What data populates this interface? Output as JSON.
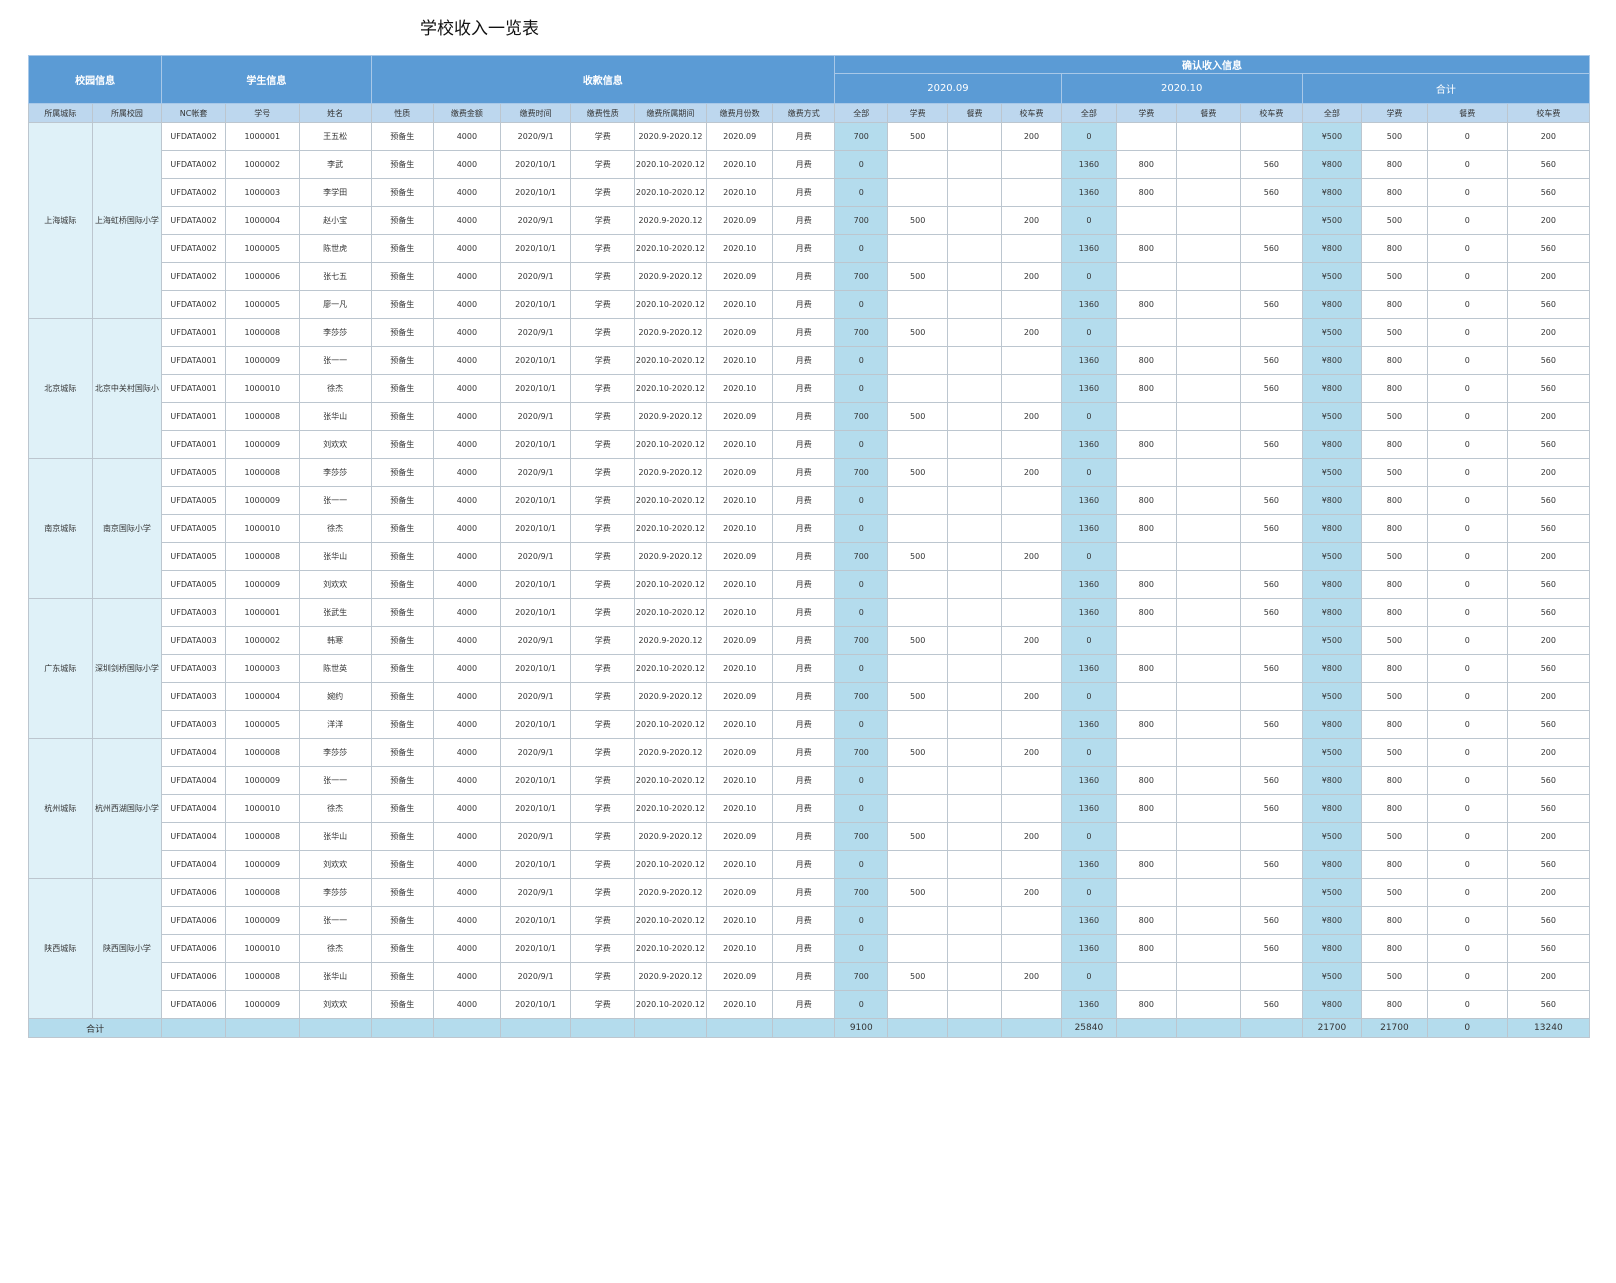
{
  "title": "学校收入一览表",
  "groups": {
    "campus": "校园信息",
    "student": "学生信息",
    "payment": "收款信息",
    "confirm": "确认收入信息"
  },
  "periods": [
    "2020.09",
    "2020.10",
    "合计"
  ],
  "columns": [
    "所属城际",
    "所属校园",
    "NC帐套",
    "学号",
    "姓名",
    "性质",
    "缴费金额",
    "缴费时间",
    "缴费性质",
    "缴费所属期间",
    "缴费月份数",
    "缴费方式",
    "全部",
    "学费",
    "餐费",
    "校车费",
    "全部",
    "学费",
    "餐费",
    "校车费",
    "全部",
    "学费",
    "餐费",
    "校车费"
  ],
  "sections": [
    {
      "city": "上海城际",
      "campus": "上海虹桥国际小学",
      "rows": [
        [
          "UFDATA002",
          "1000001",
          "王五松",
          "预备生",
          "4000",
          "2020/9/1",
          "学费",
          "2020.9-2020.12",
          "2020.09",
          "月费",
          "700",
          "500",
          "",
          "200",
          "0",
          "",
          "",
          "",
          "¥500",
          "500",
          "0",
          "200"
        ],
        [
          "UFDATA002",
          "1000002",
          "李武",
          "预备生",
          "4000",
          "2020/10/1",
          "学费",
          "2020.10-2020.12",
          "2020.10",
          "月费",
          "0",
          "",
          "",
          "",
          "1360",
          "800",
          "",
          "560",
          "¥800",
          "800",
          "0",
          "560"
        ],
        [
          "UFDATA002",
          "1000003",
          "李学田",
          "预备生",
          "4000",
          "2020/10/1",
          "学费",
          "2020.10-2020.12",
          "2020.10",
          "月费",
          "0",
          "",
          "",
          "",
          "1360",
          "800",
          "",
          "560",
          "¥800",
          "800",
          "0",
          "560"
        ],
        [
          "UFDATA002",
          "1000004",
          "赵小宝",
          "预备生",
          "4000",
          "2020/9/1",
          "学费",
          "2020.9-2020.12",
          "2020.09",
          "月费",
          "700",
          "500",
          "",
          "200",
          "0",
          "",
          "",
          "",
          "¥500",
          "500",
          "0",
          "200"
        ],
        [
          "UFDATA002",
          "1000005",
          "陈世虎",
          "预备生",
          "4000",
          "2020/10/1",
          "学费",
          "2020.10-2020.12",
          "2020.10",
          "月费",
          "0",
          "",
          "",
          "",
          "1360",
          "800",
          "",
          "560",
          "¥800",
          "800",
          "0",
          "560"
        ],
        [
          "UFDATA002",
          "1000006",
          "张七五",
          "预备生",
          "4000",
          "2020/9/1",
          "学费",
          "2020.9-2020.12",
          "2020.09",
          "月费",
          "700",
          "500",
          "",
          "200",
          "0",
          "",
          "",
          "",
          "¥500",
          "500",
          "0",
          "200"
        ],
        [
          "UFDATA002",
          "1000005",
          "廖一凡",
          "预备生",
          "4000",
          "2020/10/1",
          "学费",
          "2020.10-2020.12",
          "2020.10",
          "月费",
          "0",
          "",
          "",
          "",
          "1360",
          "800",
          "",
          "560",
          "¥800",
          "800",
          "0",
          "560"
        ]
      ]
    },
    {
      "city": "北京城际",
      "campus": "北京中关村国际小",
      "rows": [
        [
          "UFDATA001",
          "1000008",
          "李莎莎",
          "预备生",
          "4000",
          "2020/9/1",
          "学费",
          "2020.9-2020.12",
          "2020.09",
          "月费",
          "700",
          "500",
          "",
          "200",
          "0",
          "",
          "",
          "",
          "¥500",
          "500",
          "0",
          "200"
        ],
        [
          "UFDATA001",
          "1000009",
          "张一一",
          "预备生",
          "4000",
          "2020/10/1",
          "学费",
          "2020.10-2020.12",
          "2020.10",
          "月费",
          "0",
          "",
          "",
          "",
          "1360",
          "800",
          "",
          "560",
          "¥800",
          "800",
          "0",
          "560"
        ],
        [
          "UFDATA001",
          "1000010",
          "徐杰",
          "预备生",
          "4000",
          "2020/10/1",
          "学费",
          "2020.10-2020.12",
          "2020.10",
          "月费",
          "0",
          "",
          "",
          "",
          "1360",
          "800",
          "",
          "560",
          "¥800",
          "800",
          "0",
          "560"
        ],
        [
          "UFDATA001",
          "1000008",
          "张华山",
          "预备生",
          "4000",
          "2020/9/1",
          "学费",
          "2020.9-2020.12",
          "2020.09",
          "月费",
          "700",
          "500",
          "",
          "200",
          "0",
          "",
          "",
          "",
          "¥500",
          "500",
          "0",
          "200"
        ],
        [
          "UFDATA001",
          "1000009",
          "刘欢欢",
          "预备生",
          "4000",
          "2020/10/1",
          "学费",
          "2020.10-2020.12",
          "2020.10",
          "月费",
          "0",
          "",
          "",
          "",
          "1360",
          "800",
          "",
          "560",
          "¥800",
          "800",
          "0",
          "560"
        ]
      ]
    },
    {
      "city": "南京城际",
      "campus": "南京国际小学",
      "rows": [
        [
          "UFDATA005",
          "1000008",
          "李莎莎",
          "预备生",
          "4000",
          "2020/9/1",
          "学费",
          "2020.9-2020.12",
          "2020.09",
          "月费",
          "700",
          "500",
          "",
          "200",
          "0",
          "",
          "",
          "",
          "¥500",
          "500",
          "0",
          "200"
        ],
        [
          "UFDATA005",
          "1000009",
          "张一一",
          "预备生",
          "4000",
          "2020/10/1",
          "学费",
          "2020.10-2020.12",
          "2020.10",
          "月费",
          "0",
          "",
          "",
          "",
          "1360",
          "800",
          "",
          "560",
          "¥800",
          "800",
          "0",
          "560"
        ],
        [
          "UFDATA005",
          "1000010",
          "徐杰",
          "预备生",
          "4000",
          "2020/10/1",
          "学费",
          "2020.10-2020.12",
          "2020.10",
          "月费",
          "0",
          "",
          "",
          "",
          "1360",
          "800",
          "",
          "560",
          "¥800",
          "800",
          "0",
          "560"
        ],
        [
          "UFDATA005",
          "1000008",
          "张华山",
          "预备生",
          "4000",
          "2020/9/1",
          "学费",
          "2020.9-2020.12",
          "2020.09",
          "月费",
          "700",
          "500",
          "",
          "200",
          "0",
          "",
          "",
          "",
          "¥500",
          "500",
          "0",
          "200"
        ],
        [
          "UFDATA005",
          "1000009",
          "刘欢欢",
          "预备生",
          "4000",
          "2020/10/1",
          "学费",
          "2020.10-2020.12",
          "2020.10",
          "月费",
          "0",
          "",
          "",
          "",
          "1360",
          "800",
          "",
          "560",
          "¥800",
          "800",
          "0",
          "560"
        ]
      ]
    },
    {
      "city": "广东城际",
      "campus": "深圳剑桥国际小学",
      "rows": [
        [
          "UFDATA003",
          "1000001",
          "张武生",
          "预备生",
          "4000",
          "2020/10/1",
          "学费",
          "2020.10-2020.12",
          "2020.10",
          "月费",
          "0",
          "",
          "",
          "",
          "1360",
          "800",
          "",
          "560",
          "¥800",
          "800",
          "0",
          "560"
        ],
        [
          "UFDATA003",
          "1000002",
          "韩寒",
          "预备生",
          "4000",
          "2020/9/1",
          "学费",
          "2020.9-2020.12",
          "2020.09",
          "月费",
          "700",
          "500",
          "",
          "200",
          "0",
          "",
          "",
          "",
          "¥500",
          "500",
          "0",
          "200"
        ],
        [
          "UFDATA003",
          "1000003",
          "陈世英",
          "预备生",
          "4000",
          "2020/10/1",
          "学费",
          "2020.10-2020.12",
          "2020.10",
          "月费",
          "0",
          "",
          "",
          "",
          "1360",
          "800",
          "",
          "560",
          "¥800",
          "800",
          "0",
          "560"
        ],
        [
          "UFDATA003",
          "1000004",
          "婉约",
          "预备生",
          "4000",
          "2020/9/1",
          "学费",
          "2020.9-2020.12",
          "2020.09",
          "月费",
          "700",
          "500",
          "",
          "200",
          "0",
          "",
          "",
          "",
          "¥500",
          "500",
          "0",
          "200"
        ],
        [
          "UFDATA003",
          "1000005",
          "洋洋",
          "预备生",
          "4000",
          "2020/10/1",
          "学费",
          "2020.10-2020.12",
          "2020.10",
          "月费",
          "0",
          "",
          "",
          "",
          "1360",
          "800",
          "",
          "560",
          "¥800",
          "800",
          "0",
          "560"
        ]
      ]
    },
    {
      "city": "杭州城际",
      "campus": "杭州西湖国际小学",
      "rows": [
        [
          "UFDATA004",
          "1000008",
          "李莎莎",
          "预备生",
          "4000",
          "2020/9/1",
          "学费",
          "2020.9-2020.12",
          "2020.09",
          "月费",
          "700",
          "500",
          "",
          "200",
          "0",
          "",
          "",
          "",
          "¥500",
          "500",
          "0",
          "200"
        ],
        [
          "UFDATA004",
          "1000009",
          "张一一",
          "预备生",
          "4000",
          "2020/10/1",
          "学费",
          "2020.10-2020.12",
          "2020.10",
          "月费",
          "0",
          "",
          "",
          "",
          "1360",
          "800",
          "",
          "560",
          "¥800",
          "800",
          "0",
          "560"
        ],
        [
          "UFDATA004",
          "1000010",
          "徐杰",
          "预备生",
          "4000",
          "2020/10/1",
          "学费",
          "2020.10-2020.12",
          "2020.10",
          "月费",
          "0",
          "",
          "",
          "",
          "1360",
          "800",
          "",
          "560",
          "¥800",
          "800",
          "0",
          "560"
        ],
        [
          "UFDATA004",
          "1000008",
          "张华山",
          "预备生",
          "4000",
          "2020/9/1",
          "学费",
          "2020.9-2020.12",
          "2020.09",
          "月费",
          "700",
          "500",
          "",
          "200",
          "0",
          "",
          "",
          "",
          "¥500",
          "500",
          "0",
          "200"
        ],
        [
          "UFDATA004",
          "1000009",
          "刘欢欢",
          "预备生",
          "4000",
          "2020/10/1",
          "学费",
          "2020.10-2020.12",
          "2020.10",
          "月费",
          "0",
          "",
          "",
          "",
          "1360",
          "800",
          "",
          "560",
          "¥800",
          "800",
          "0",
          "560"
        ]
      ]
    },
    {
      "city": "陕西城际",
      "campus": "陕西国际小学",
      "rows": [
        [
          "UFDATA006",
          "1000008",
          "李莎莎",
          "预备生",
          "4000",
          "2020/9/1",
          "学费",
          "2020.9-2020.12",
          "2020.09",
          "月费",
          "700",
          "500",
          "",
          "200",
          "0",
          "",
          "",
          "",
          "¥500",
          "500",
          "0",
          "200"
        ],
        [
          "UFDATA006",
          "1000009",
          "张一一",
          "预备生",
          "4000",
          "2020/10/1",
          "学费",
          "2020.10-2020.12",
          "2020.10",
          "月费",
          "0",
          "",
          "",
          "",
          "1360",
          "800",
          "",
          "560",
          "¥800",
          "800",
          "0",
          "560"
        ],
        [
          "UFDATA006",
          "1000010",
          "徐杰",
          "预备生",
          "4000",
          "2020/10/1",
          "学费",
          "2020.10-2020.12",
          "2020.10",
          "月费",
          "0",
          "",
          "",
          "",
          "1360",
          "800",
          "",
          "560",
          "¥800",
          "800",
          "0",
          "560"
        ],
        [
          "UFDATA006",
          "1000008",
          "张华山",
          "预备生",
          "4000",
          "2020/9/1",
          "学费",
          "2020.9-2020.12",
          "2020.09",
          "月费",
          "700",
          "500",
          "",
          "200",
          "0",
          "",
          "",
          "",
          "¥500",
          "500",
          "0",
          "200"
        ],
        [
          "UFDATA006",
          "1000009",
          "刘欢欢",
          "预备生",
          "4000",
          "2020/10/1",
          "学费",
          "2020.10-2020.12",
          "2020.10",
          "月费",
          "0",
          "",
          "",
          "",
          "1360",
          "800",
          "",
          "560",
          "¥800",
          "800",
          "0",
          "560"
        ]
      ]
    }
  ],
  "total": {
    "label": "合计",
    "cells": [
      "",
      "",
      "",
      "",
      "",
      "",
      "",
      "",
      "",
      "",
      "9100",
      "",
      "",
      "",
      "25840",
      "",
      "",
      "",
      "21700",
      "21700",
      "0",
      "13240"
    ]
  },
  "colors": {
    "header": "#5b9bd5",
    "subheader": "#bdd7ee",
    "highlight": "#b4dced",
    "group": "#dff1f8"
  }
}
